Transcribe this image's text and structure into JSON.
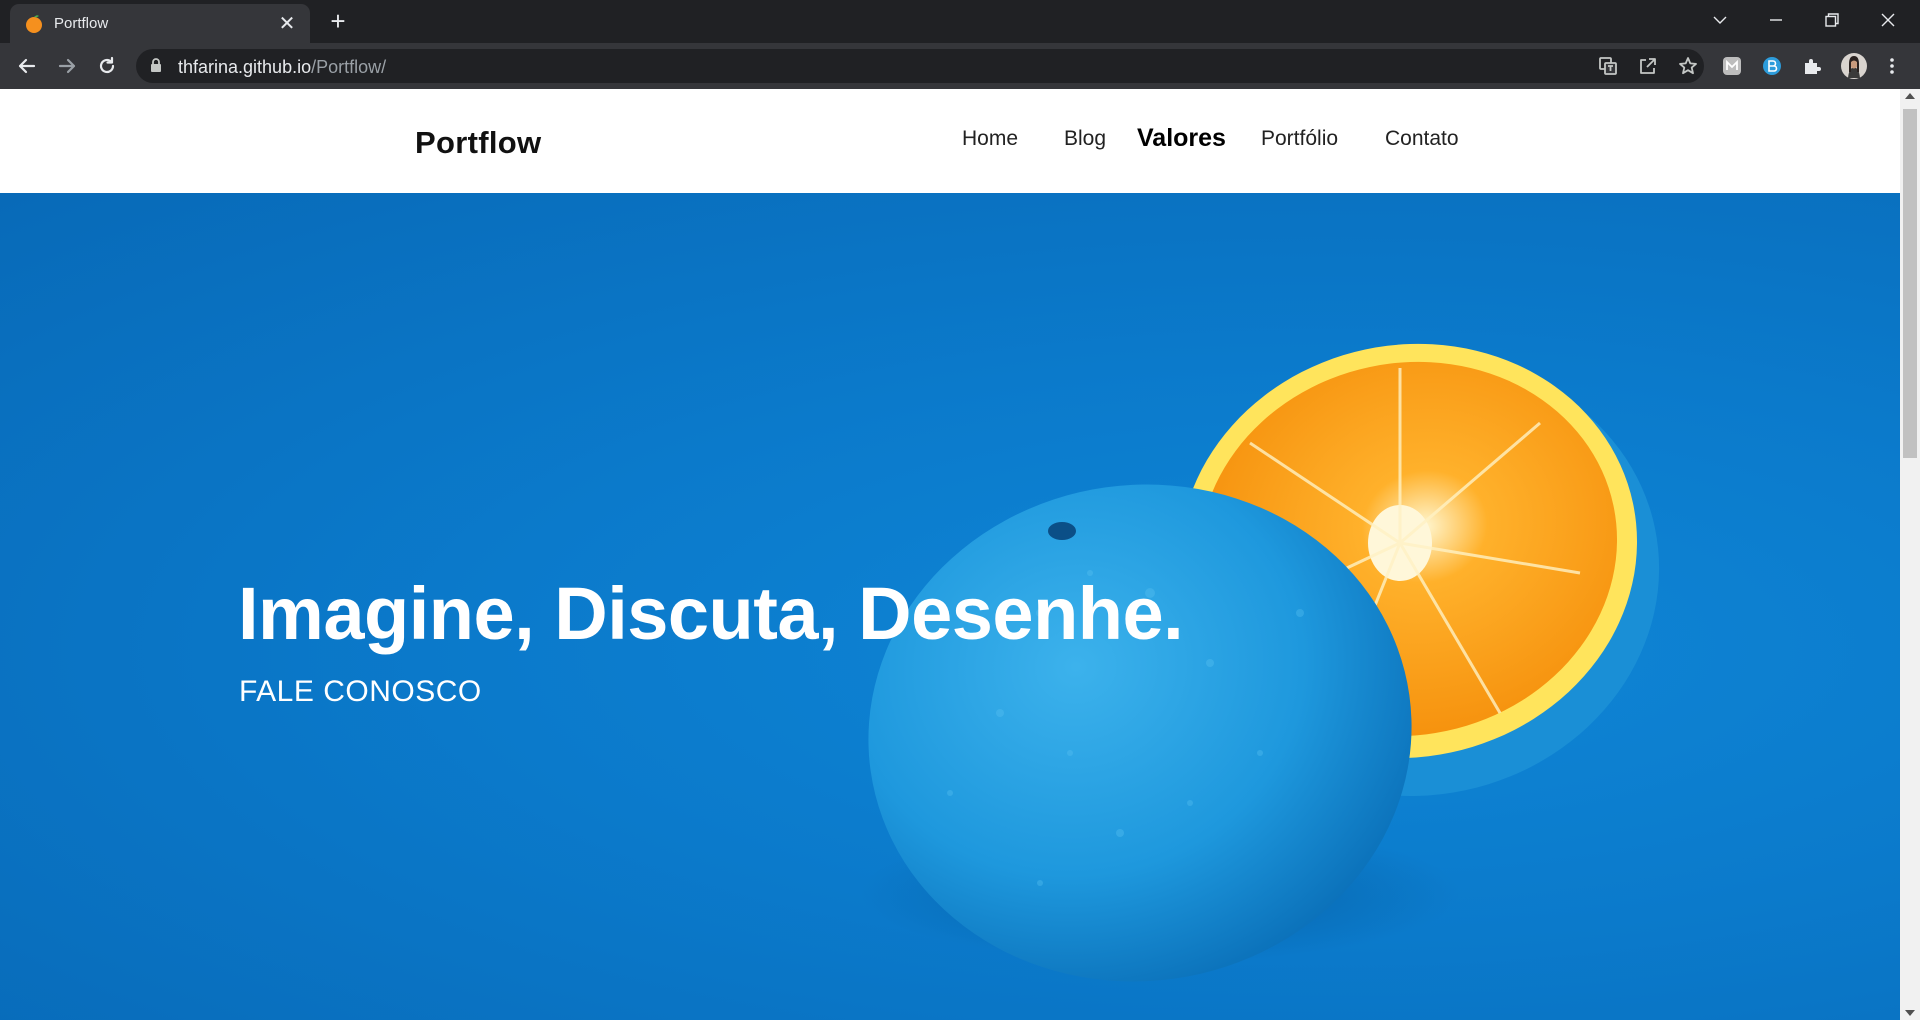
{
  "browser": {
    "tab": {
      "title": "Portflow",
      "favicon": "orange-icon",
      "close_glyph": "✕"
    },
    "new_tab_glyph": "+",
    "url": {
      "host": "thfarina.github.io",
      "path": "/Portflow/"
    },
    "toolbar_icons": [
      "back-icon",
      "forward-icon",
      "reload-icon",
      "lock-icon",
      "translate-icon",
      "share-icon",
      "star-icon",
      "extension-m-icon",
      "extension-b-icon",
      "puzzle-icon",
      "profile-avatar",
      "kebab-menu-icon"
    ],
    "window_controls": [
      "tab-search-icon",
      "minimize-icon",
      "restore-icon",
      "close-icon"
    ],
    "colors": {
      "frame": "#202124",
      "toolbar": "#35363a",
      "text": "#e8eaed"
    }
  },
  "site": {
    "logo": "Portflow",
    "nav": [
      {
        "label": "Home",
        "active": false
      },
      {
        "label": "Blog",
        "active": false
      },
      {
        "label": "Valores",
        "active": true
      },
      {
        "label": "Portfólio",
        "active": false
      },
      {
        "label": "Contato",
        "active": false
      }
    ],
    "hero": {
      "headline": "Imagine, Discuta, Desenhe.",
      "cta": "FALE CONOSCO",
      "image": "blue-painted-orange-halves",
      "colors": {
        "background": "#0b78c9",
        "orange_flesh": "#ffa21a",
        "orange_peel": "#ffd84a"
      }
    }
  }
}
